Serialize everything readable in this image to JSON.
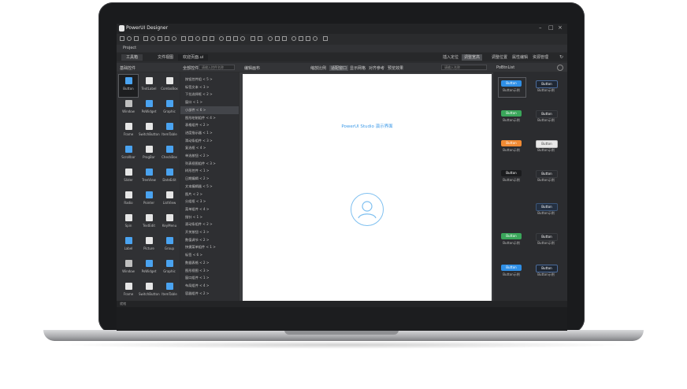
{
  "app": {
    "title": "PowerUI Designer",
    "window_controls": [
      "–",
      "□",
      "×"
    ]
  },
  "menubar": {
    "project_label": "Project"
  },
  "tabs": {
    "left": [
      "工具箱",
      "文件视图"
    ],
    "doc_title": "欢迎页面.ui",
    "right": [
      "插入定位",
      "调整宽高",
      "调整位置",
      "属性编辑",
      "资源管理"
    ]
  },
  "panels": {
    "palette_header": "基础控件",
    "list_header": "全部控件",
    "list_search_placeholder": "请输入控件名称",
    "canvas_header": "编辑画布",
    "canvas_controls": [
      "缩放比例",
      "适配窗口",
      "显示网格",
      "对齐参考",
      "预览效果"
    ],
    "canvas_search_placeholder": "请输入名称",
    "right_header": "PoBtnList"
  },
  "palette": [
    {
      "label": "Button",
      "icon": "button-icon",
      "color": "#4aa3f0"
    },
    {
      "label": "TextLabel",
      "icon": "label-icon",
      "color": "#e6e6e6"
    },
    {
      "label": "ComboBox",
      "icon": "combobox-icon",
      "color": "#e6e6e6"
    },
    {
      "label": "Window",
      "icon": "window-icon",
      "color": "#bfbfbf"
    },
    {
      "label": "PoWidget",
      "icon": "widget-icon",
      "color": "#4aa3f0"
    },
    {
      "label": "Graphic",
      "icon": "graphic-icon",
      "color": "#4aa3f0"
    },
    {
      "label": "Frame",
      "icon": "frame-icon",
      "color": "#e6e6e6"
    },
    {
      "label": "SwitchButton",
      "icon": "switch-icon",
      "color": "#e6e6e6"
    },
    {
      "label": "ItemTable",
      "icon": "table-icon",
      "color": "#4aa3f0"
    },
    {
      "label": "Scrollbar",
      "icon": "scrollbar-icon",
      "color": "#4aa3f0"
    },
    {
      "label": "ProgBar",
      "icon": "progressbar-icon",
      "color": "#e6e6e6"
    },
    {
      "label": "CheckBox",
      "icon": "checkbox-icon",
      "color": "#4aa3f0"
    },
    {
      "label": "Slider",
      "icon": "slider-icon",
      "color": "#e6e6e6"
    },
    {
      "label": "TreeView",
      "icon": "tree-icon",
      "color": "#4aa3f0"
    },
    {
      "label": "DateEdit",
      "icon": "dateedit-icon",
      "color": "#4aa3f0"
    },
    {
      "label": "Radio",
      "icon": "radio-icon",
      "color": "#e6e6e6"
    },
    {
      "label": "Pointer",
      "icon": "pointer-icon",
      "color": "#4aa3f0"
    },
    {
      "label": "ListView",
      "icon": "listview-icon",
      "color": "#e6e6e6"
    },
    {
      "label": "Spin",
      "icon": "spin-icon",
      "color": "#e6e6e6"
    },
    {
      "label": "TextEdit",
      "icon": "textedit-icon",
      "color": "#e6e6e6"
    },
    {
      "label": "KeyMenu",
      "icon": "menu-icon",
      "color": "#e6e6e6"
    },
    {
      "label": "Label",
      "icon": "label2-icon",
      "color": "#4aa3f0"
    },
    {
      "label": "Picture",
      "icon": "picture-icon",
      "color": "#e6e6e6"
    },
    {
      "label": "Group",
      "icon": "group-icon",
      "color": "#4aa3f0"
    },
    {
      "label": "Window",
      "icon": "window2-icon",
      "color": "#bfbfbf"
    },
    {
      "label": "PoWidget",
      "icon": "widget2-icon",
      "color": "#4aa3f0"
    },
    {
      "label": "Graphic",
      "icon": "graphic2-icon",
      "color": "#4aa3f0"
    },
    {
      "label": "Frame",
      "icon": "frame2-icon",
      "color": "#e6e6e6"
    },
    {
      "label": "SwitchButton",
      "icon": "switch2-icon",
      "color": "#e6e6e6"
    },
    {
      "label": "ItemTable",
      "icon": "table2-icon",
      "color": "#4aa3f0"
    }
  ],
  "control_list": [
    "按钮控件组 < 5 >",
    "标签文本 < 3 >",
    "下拉选择框 < 2 >",
    "窗口 < 1 >",
    "小部件 < 6 >",
    "图形绘制组件 < 4 >",
    "表格组件 < 2 >",
    "进度指示器 < 1 >",
    "滑动条组件 < 3 >",
    "复选框 < 4 >",
    "单选按钮 < 2 >",
    "列表视图组件 < 3 >",
    "树形控件 < 1 >",
    "日期编辑 < 2 >",
    "文本编辑器 < 5 >",
    "图片 < 2 >",
    "分组框 < 3 >",
    "菜单组件 < 4 >",
    "指针 < 1 >",
    "滚动条组件 < 2 >",
    "开关按钮 < 3 >",
    "数值调节 < 2 >",
    "快捷菜单组件 < 1 >",
    "标签 < 6 >",
    "数据表格 < 2 >",
    "图形视图 < 3 >",
    "窗口组件 < 1 >",
    "布局组件 < 4 >",
    "容器组件 < 2 >"
  ],
  "list_selected_index": 4,
  "canvas": {
    "title": "PowerUI Studio 演示界面"
  },
  "btn_demo": {
    "label": "Button",
    "caption": "Button示例",
    "styles": [
      {
        "left": "#2f8fe6",
        "right": "#1f2733",
        "right_border": "#4a6a9a"
      },
      {
        "left": "#3aa65a",
        "right": "#2a2c30",
        "right_border": "#3a3c40"
      },
      {
        "left": "#f08a33",
        "right": "#e8e8e8",
        "right_border": "#bdbdbd"
      },
      {
        "left": "#1b1c1e",
        "right": "#2a2c30",
        "right_border": "#3a3c40"
      },
      {
        "left": "",
        "right": "#243041",
        "right_border": "#3b5578"
      },
      {
        "left": "#3aa65a",
        "right": "#2a2c30",
        "right_border": "#3a3c40"
      },
      {
        "left": "#2f8fe6",
        "right": "#1f2733",
        "right_border": "#4a6a9a"
      }
    ]
  },
  "status": {
    "text": "就绪"
  }
}
